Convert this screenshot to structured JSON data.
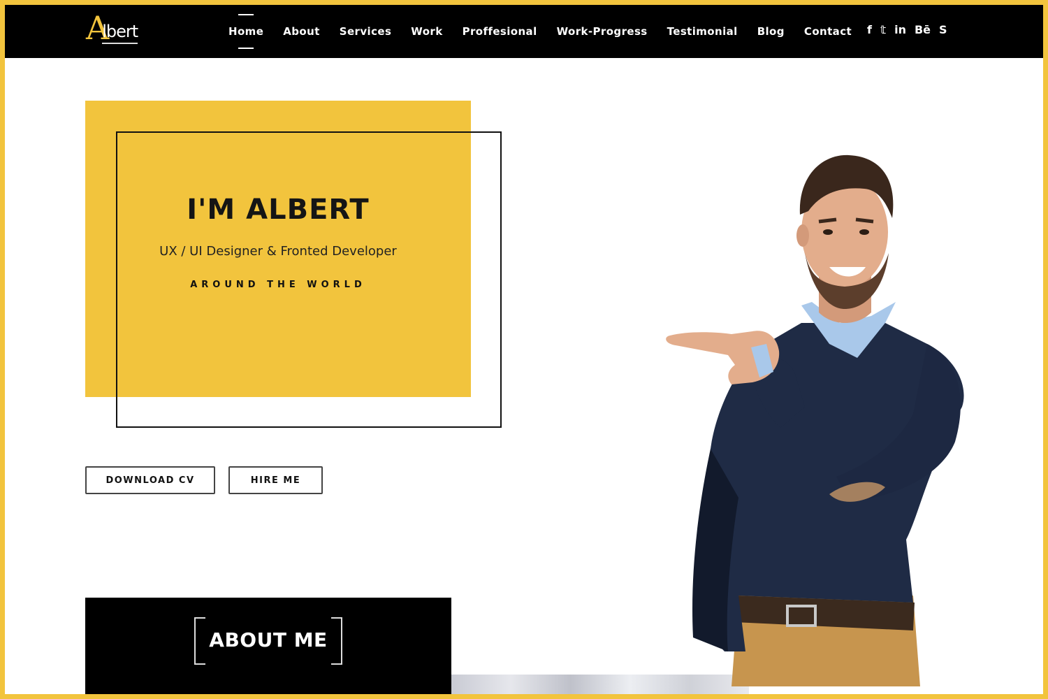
{
  "nav": {
    "logo_a": "A",
    "logo_rest": "lbert",
    "items": [
      {
        "label": "Home",
        "active": true
      },
      {
        "label": "About"
      },
      {
        "label": "Services"
      },
      {
        "label": "Work"
      },
      {
        "label": "Proffesional"
      },
      {
        "label": "Work-Progress"
      },
      {
        "label": "Testimonial"
      },
      {
        "label": "Blog"
      },
      {
        "label": "Contact"
      }
    ],
    "social": [
      "f",
      "𝕥",
      "in",
      "Bē",
      "S"
    ],
    "social_icons": [
      "facebook-icon",
      "twitter-icon",
      "linkedin-icon",
      "behance-icon",
      "skype-icon"
    ]
  },
  "hero": {
    "title": "I'M ALBERT",
    "subtitle": "UX / UI Designer & Fronted Developer",
    "tagline": "AROUND THE WORLD",
    "download_label": "DOWNLOAD CV",
    "hire_label": "HIRE ME"
  },
  "about": {
    "title": "ABOUT ME"
  },
  "colors": {
    "accent": "#f2c43d",
    "dark": "#000000",
    "background": "#ffffff"
  }
}
